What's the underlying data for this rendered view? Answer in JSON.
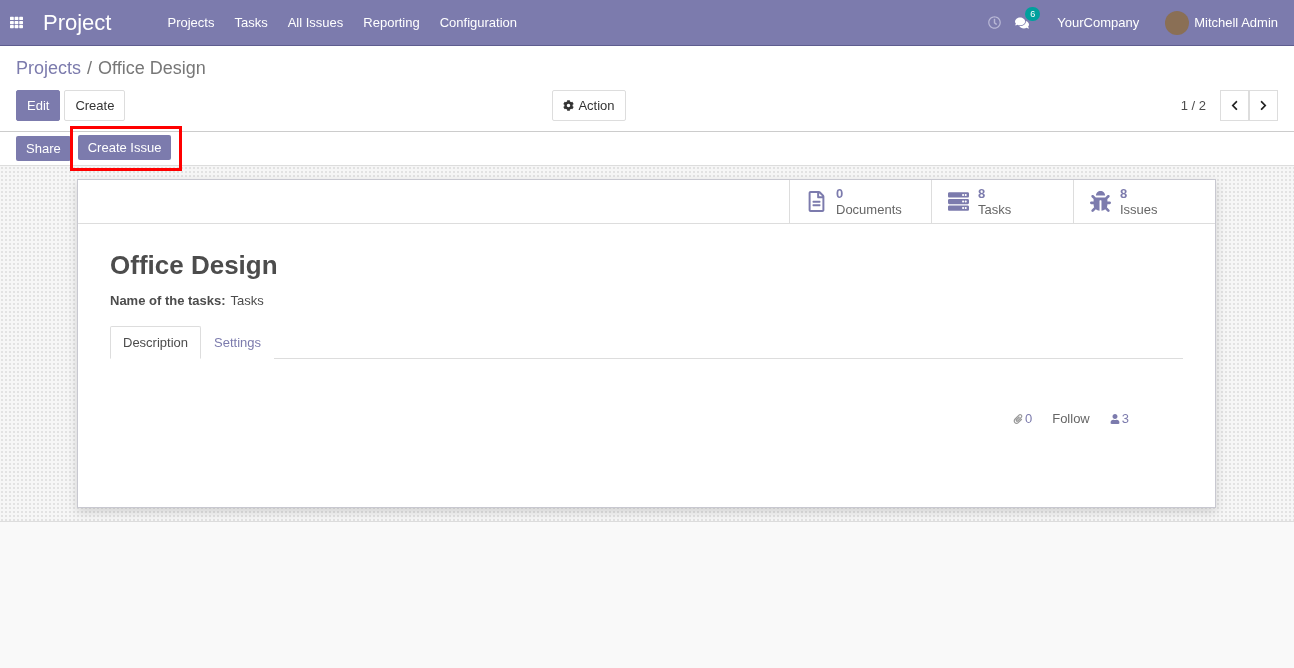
{
  "navbar": {
    "app_title": "Project",
    "menu": [
      "Projects",
      "Tasks",
      "All Issues",
      "Reporting",
      "Configuration"
    ],
    "message_count": "6",
    "company": "YourCompany",
    "user": "Mitchell Admin"
  },
  "breadcrumb_separator": "/",
  "breadcrumb": [
    {
      "label": "Projects",
      "kind": "link"
    },
    {
      "label": "Office Design",
      "kind": "current"
    }
  ],
  "buttons": {
    "edit": "Edit",
    "create": "Create",
    "action": "Action"
  },
  "pager": {
    "value": "1 / 2"
  },
  "header_buttons": [
    {
      "label": "Share",
      "highlighted": false
    },
    {
      "label": "Create Issue",
      "highlighted": true
    }
  ],
  "stat_buttons": [
    {
      "kind": "document",
      "count": "0",
      "label": "Documents"
    },
    {
      "kind": "tasks",
      "count": "8",
      "label": "Tasks"
    },
    {
      "kind": "bug",
      "count": "8",
      "label": "Issues"
    }
  ],
  "record": {
    "title": "Office Design",
    "field_label": "Name of the tasks:",
    "field_value": "Tasks"
  },
  "tabs": [
    {
      "label": "Description",
      "selected": true
    },
    {
      "label": "Settings",
      "selected": false
    }
  ],
  "chatter": {
    "attachments": "0",
    "follow": "Follow",
    "followers": "3"
  }
}
